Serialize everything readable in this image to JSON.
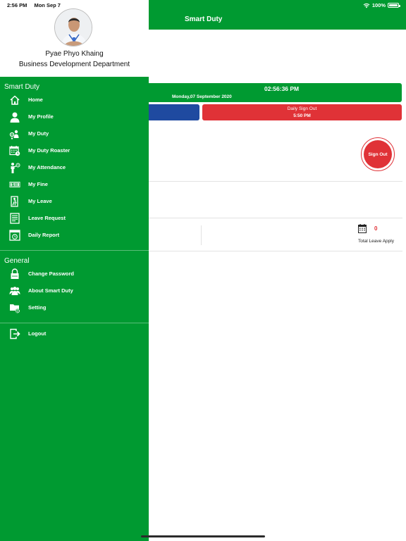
{
  "status_bar": {
    "time": "2:56 PM",
    "date": "Mon Sep 7",
    "battery": "100%"
  },
  "app": {
    "title": "Smart Duty",
    "clock_time": "02:56:36 PM",
    "clock_date": "Monday,07 September 2020",
    "sign_out_label": "Daily Sign Out",
    "sign_out_time": "5:50 PM",
    "sign_out_button": "Sign Out",
    "leave_count": "0",
    "leave_label": "Total Leave Apply"
  },
  "drawer": {
    "profile": {
      "name": "Pyae Phyo Khaing",
      "department": "Business Development Department"
    },
    "section_main": "Smart Duty",
    "items": [
      {
        "label": "Home",
        "icon": "home-icon"
      },
      {
        "label": "My Profile",
        "icon": "user-icon"
      },
      {
        "label": "My Duty",
        "icon": "duty-icon"
      },
      {
        "label": "My Duty Roaster",
        "icon": "calendar-icon"
      },
      {
        "label": "My Attendance",
        "icon": "attendance-icon"
      },
      {
        "label": "My Fine",
        "icon": "money-icon"
      },
      {
        "label": "My Leave",
        "icon": "exit-door-icon"
      },
      {
        "label": "Leave Request",
        "icon": "form-icon"
      },
      {
        "label": "Daily Report",
        "icon": "report-icon"
      }
    ],
    "section_general": "General",
    "general_items": [
      {
        "label": "Change Password",
        "icon": "lock-icon"
      },
      {
        "label": "About Smart Duty",
        "icon": "group-icon"
      },
      {
        "label": "Setting",
        "icon": "folder-settings-icon"
      }
    ],
    "logout": {
      "label": "Logout",
      "icon": "logout-icon"
    }
  },
  "colors": {
    "primary_green": "#009a31",
    "sign_out_red": "#e03237",
    "sign_in_blue": "#1f4aa0"
  }
}
